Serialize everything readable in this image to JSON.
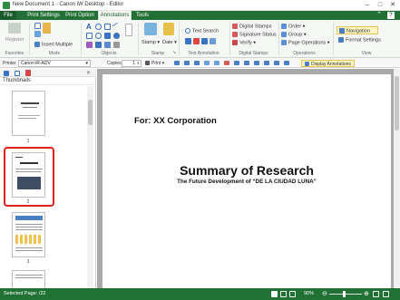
{
  "window": {
    "title": "New Document 1 - Canon iW Desktop - Editor"
  },
  "tabs": [
    {
      "label": "File"
    },
    {
      "label": "Print Settings"
    },
    {
      "label": "Print Option"
    },
    {
      "label": "Annotations",
      "active": true
    },
    {
      "label": "Tools"
    }
  ],
  "ribbon": {
    "favorites": {
      "register_label": "Register",
      "group_label": "Favorites"
    },
    "mode": {
      "insert_multiple_label": "Insert Multiple",
      "group_label": "Mode"
    },
    "objects": {
      "group_label": "Objects"
    },
    "stamp": {
      "stamp_label": "Stamp",
      "date_label": "Date",
      "group_label": "Stamp"
    },
    "text_annotation": {
      "text_search_label": "Text Search",
      "group_label": "Text Annotation"
    },
    "digital_stamps": {
      "digital_stamps_label": "Digital Stamps",
      "signature_status_label": "Signature Status",
      "verify_label": "Verify",
      "group_label": "Digital Stamps"
    },
    "operations": {
      "order_label": "Order",
      "group_label_btn": "Group",
      "page_operations_label": "Page Operations",
      "group_label": "Operations"
    },
    "view": {
      "navigation_label": "Navigation",
      "format_settings_label": "Format Settings",
      "group_label": "View"
    }
  },
  "options_bar": {
    "printer_label": "Printer",
    "printer_value": "Canon iR-ADV",
    "copies_label": "Copies",
    "copies_value": "1",
    "print_label": "Print",
    "display_annotations_label": "Display Annotations"
  },
  "sidebar": {
    "label": "Thumbnails",
    "pages": [
      {
        "number": "1"
      },
      {
        "number": "2",
        "selected": true
      },
      {
        "number": "3"
      }
    ]
  },
  "document": {
    "for_line": "For: XX Corporation",
    "title": "Summary of Research",
    "subtitle": "The Future Development of “DE LA CIUDAD LUNA”"
  },
  "status": {
    "selected_page": "Selected Page: /22",
    "zoom": "90%"
  },
  "colors": {
    "accent": "#227036",
    "selection": "#e02020",
    "highlight": "#fff4c2"
  }
}
